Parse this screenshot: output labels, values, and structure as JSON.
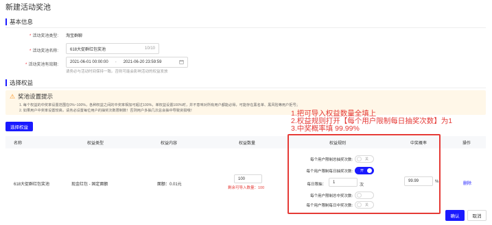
{
  "page": {
    "title": "新建活动奖池"
  },
  "basic": {
    "section_title": "基本信息",
    "type_label": "活动奖池类型:",
    "type_value": "淘宝群聊",
    "name_label": "活动奖池名称:",
    "name_value": "618大促群红包奖池",
    "name_count": "10/10",
    "period_label": "活动奖池有效期:",
    "start": "2021-06-01 00:00:00",
    "sep": "-",
    "end": "2021-06-20 23:59:59",
    "period_help": "请务必与活动时间保持一致。否则可能会影响活动的权益发放"
  },
  "rights": {
    "section_title": "选择权益",
    "notice_title": "奖池设置提示",
    "notice_lines": [
      "1. 每个权益的中奖率设置范围在0%~100%，各种权益之间的中奖率相加可超过100%，单权益设置100%时，并不意味对所有用户都能必得，可能存在黑名单、黑风险等用户拒号；",
      "2. 如果用户中奖率设置较高，请务必设置每位用户的抽奖次数限制数！否则用户多抽几次总会抽中导致资损哦！"
    ],
    "select_button": "选择权益",
    "columns": [
      "名称",
      "权益类型",
      "权益内容",
      "权益数量",
      "权益规则",
      "中奖概率",
      "操作"
    ],
    "row": {
      "name": "618大促群红包奖池",
      "type": "现金红包 - 固定面额",
      "content": "面额：0.01元",
      "quantity": "100",
      "remaining": "剩余可导入数量：100",
      "rules": {
        "total_limit_label": "每个用户限制总抽奖次数:",
        "total_limit_state": "关",
        "daily_limit_label": "每个用户限制每日抽奖次数:",
        "daily_limit_state": "开",
        "daily_max_label": "每日限抽：",
        "daily_max_value": "1",
        "daily_max_unit": "次",
        "total_win_label": "每个用户限制总中奖次数:",
        "total_win_state": "",
        "daily_win_label": "每个用户限制每日中奖次数:",
        "daily_win_state": "关"
      },
      "probability": "99.99",
      "probability_unit": "%",
      "action": "删除"
    }
  },
  "annotation": {
    "lines": [
      "1.把可导入权益数量全填上",
      "2.权益规则打开【每个用户限制每日抽奖次数】为1",
      "3.中奖概率填 99.99%"
    ]
  },
  "footer": {
    "confirm": "确认",
    "cancel": "取消"
  },
  "colors": {
    "primary": "#1a1aff",
    "annotation_red": "#e53935",
    "notice_bg": "#fff7e8",
    "required": "#f5222d"
  }
}
